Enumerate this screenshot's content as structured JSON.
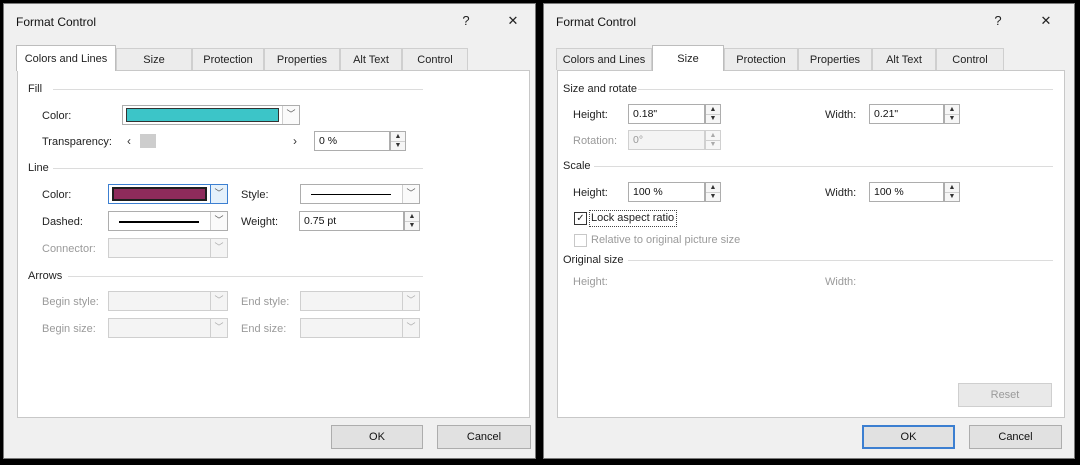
{
  "left": {
    "title": "Format Control",
    "help_glyph": "?",
    "close_glyph": "✕",
    "tabs": [
      "Colors and Lines",
      "Size",
      "Protection",
      "Properties",
      "Alt Text",
      "Control"
    ],
    "active_tab": "Colors and Lines",
    "fill": {
      "section": "Fill",
      "color_label": "Color:",
      "color_value": "#3cc5c8",
      "transparency_label": "Transparency:",
      "transparency_value": "0 %"
    },
    "line": {
      "section": "Line",
      "color_label": "Color:",
      "color_value": "#8e2b5b",
      "dashed_label": "Dashed:",
      "connector_label": "Connector:",
      "style_label": "Style:",
      "weight_label": "Weight:",
      "weight_value": "0.75 pt"
    },
    "arrows": {
      "section": "Arrows",
      "begin_style_label": "Begin style:",
      "begin_size_label": "Begin size:",
      "end_style_label": "End style:",
      "end_size_label": "End size:"
    },
    "ok_label": "OK",
    "cancel_label": "Cancel"
  },
  "right": {
    "title": "Format Control",
    "help_glyph": "?",
    "close_glyph": "✕",
    "tabs": [
      "Colors and Lines",
      "Size",
      "Protection",
      "Properties",
      "Alt Text",
      "Control"
    ],
    "active_tab": "Size",
    "size_rotate": {
      "section": "Size and rotate",
      "height_label": "Height:",
      "height_value": "0.18\"",
      "width_label": "Width:",
      "width_value": "0.21\"",
      "rotation_label": "Rotation:",
      "rotation_value": "0°"
    },
    "scale": {
      "section": "Scale",
      "height_label": "Height:",
      "height_value": "100 %",
      "width_label": "Width:",
      "width_value": "100 %",
      "lock_label": "Lock aspect ratio",
      "lock_checked": true,
      "relative_label": "Relative to original picture size",
      "relative_checked": false
    },
    "original": {
      "section": "Original size",
      "height_label": "Height:",
      "width_label": "Width:"
    },
    "reset_label": "Reset",
    "ok_label": "OK",
    "cancel_label": "Cancel"
  },
  "icons": {
    "dropdown": "﹀",
    "spin_up": "▲",
    "spin_down": "▼",
    "scroll_left": "‹",
    "scroll_right": "›",
    "check": "✓"
  }
}
